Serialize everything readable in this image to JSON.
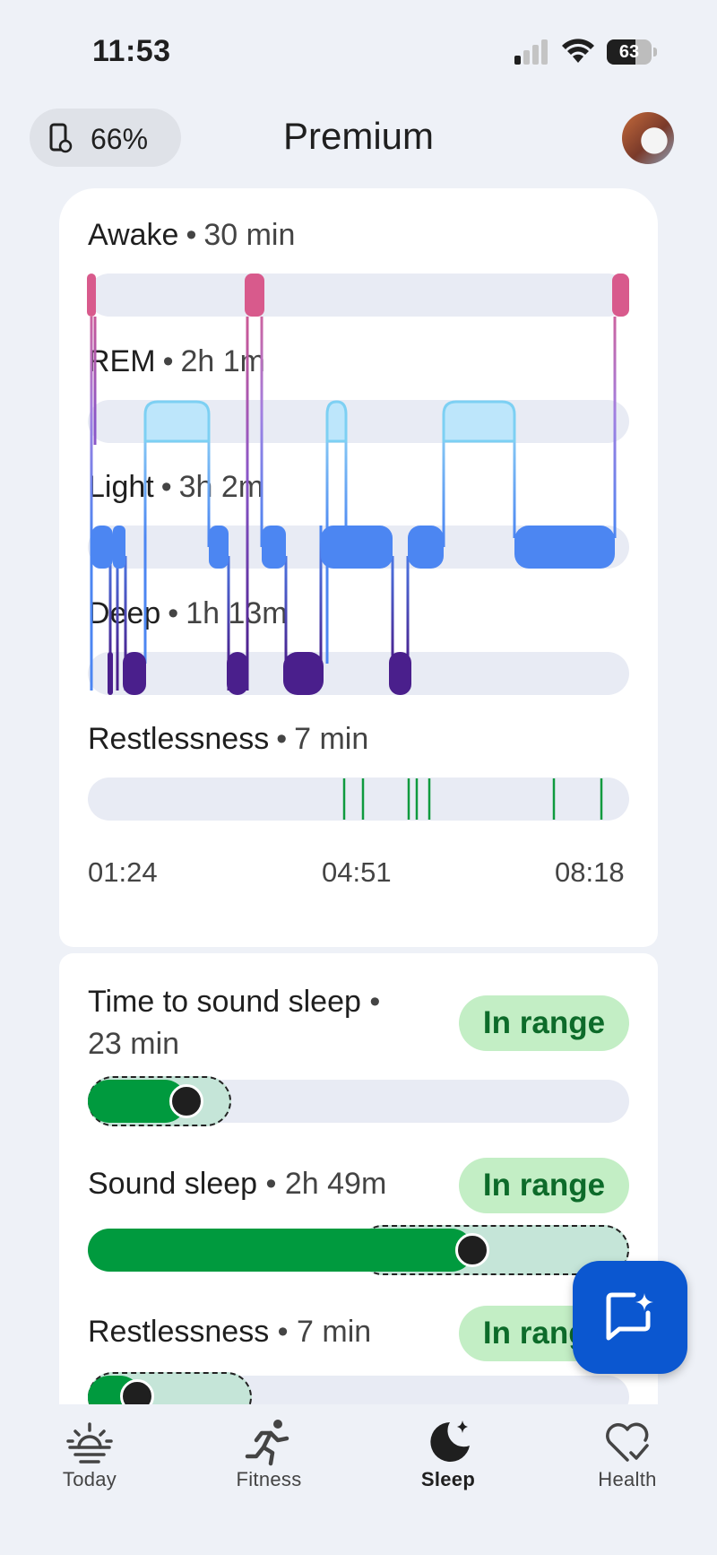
{
  "status_bar": {
    "time": "11:53",
    "battery": "63"
  },
  "header": {
    "device_battery": "66%",
    "title": "Premium"
  },
  "stages": [
    {
      "name": "Awake",
      "value": "30 min"
    },
    {
      "name": "REM",
      "value": "2h 1m"
    },
    {
      "name": "Light",
      "value": "3h 2m"
    },
    {
      "name": "Deep",
      "value": "1h 13m"
    },
    {
      "name": "Restlessness",
      "value": "7 min"
    }
  ],
  "timeline": {
    "start": "01:24",
    "mid": "04:51",
    "end": "08:18"
  },
  "metrics": [
    {
      "title": "Time to sound sleep",
      "value": "23 min",
      "status": "In range"
    },
    {
      "title": "Sound sleep",
      "value": "2h 49m",
      "status": "In range"
    },
    {
      "title": "Restlessness",
      "value": "7 min",
      "status": "In range"
    }
  ],
  "nav": [
    {
      "label": "Today",
      "icon": "sunrise-icon"
    },
    {
      "label": "Fitness",
      "icon": "running-icon"
    },
    {
      "label": "Sleep",
      "icon": "moon-icon",
      "active": true
    },
    {
      "label": "Health",
      "icon": "heart-check-icon"
    }
  ],
  "colors": {
    "awake": "#d85a8c",
    "rem": "#bde6fb",
    "light": "#4c86f2",
    "deep": "#4a1f8c",
    "restless": "#0e9a3e",
    "in_range_bg": "#c3eec5",
    "in_range_text": "#0d6b2a",
    "fab": "#0b57d0"
  }
}
